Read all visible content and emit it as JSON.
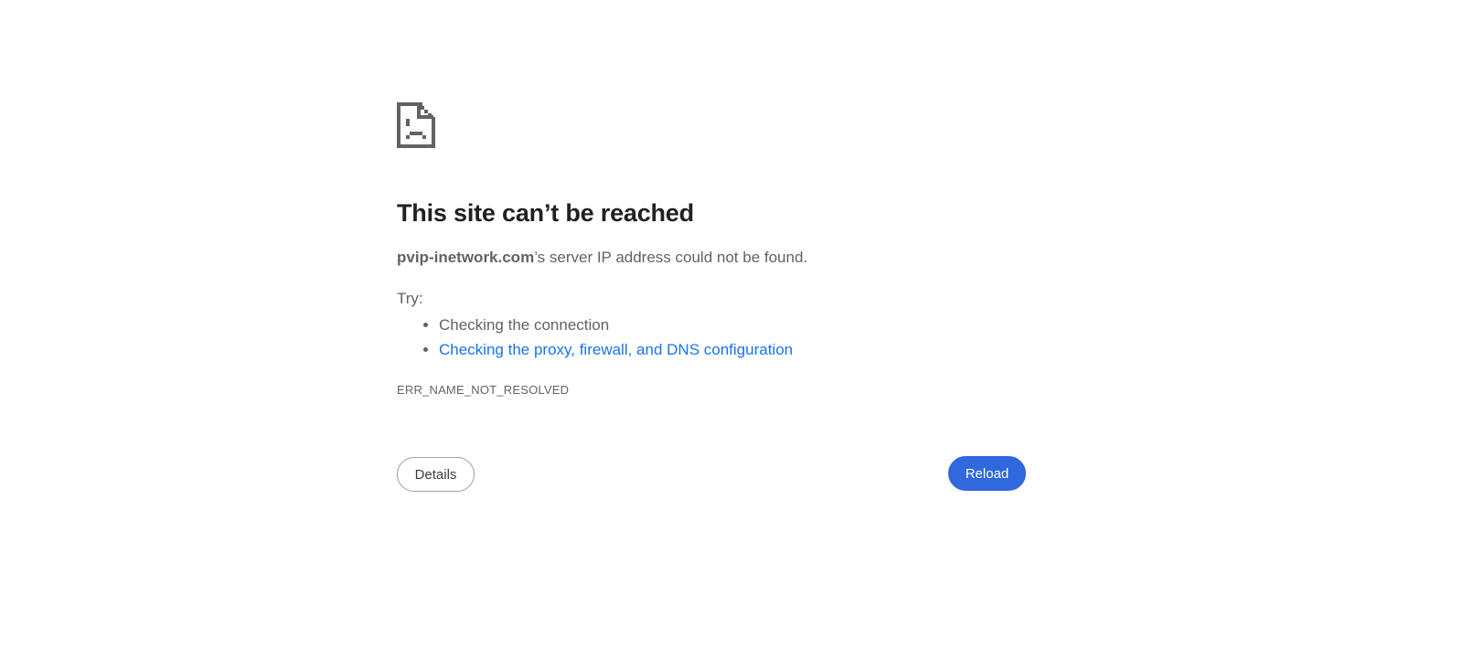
{
  "error_page": {
    "icon": "sad-document-icon",
    "headline": "This site can’t be reached",
    "summary": {
      "host": "pvip-inetwork.com",
      "message": "’s server IP address could not be found."
    },
    "try_label": "Try:",
    "suggestions": [
      {
        "label": "Checking the connection",
        "is_link": false
      },
      {
        "label": "Checking the proxy, firewall, and DNS configuration",
        "is_link": true
      }
    ],
    "error_code": "ERR_NAME_NOT_RESOLVED"
  },
  "buttons": {
    "details_label": "Details",
    "reload_label": "Reload"
  },
  "colors": {
    "headline": "#202124",
    "body_text": "#5f6368",
    "link": "#1a73e8",
    "reload_button": "#3168dd"
  }
}
